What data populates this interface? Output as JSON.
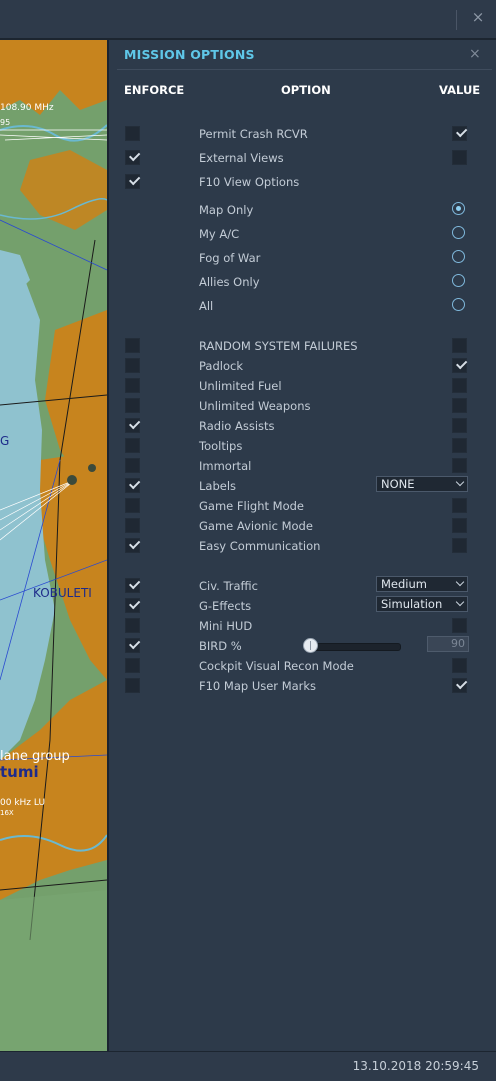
{
  "window": {
    "close_label": "×"
  },
  "map": {
    "freq_top": "108.90 MHz",
    "freq_top_sub": "95",
    "letter_g": "G",
    "town": "KOBULETI",
    "group": "lane group",
    "city": "tumi",
    "freq_bottom": "00 kHz LU",
    "freq_bottom_sub": "16X"
  },
  "panel": {
    "title": "MISSION OPTIONS",
    "close_label": "×",
    "headers": {
      "enforce": "ENFORCE",
      "option": "OPTION",
      "value": "VALUE"
    }
  },
  "options": [
    {
      "label": "Permit Crash RCVR",
      "enforce": false,
      "value_type": "checkbox",
      "value": true
    },
    {
      "label": "External Views",
      "enforce": true,
      "value_type": "checkbox",
      "value": false
    },
    {
      "label": "F10 View Options",
      "enforce": true,
      "value_type": "none"
    },
    {
      "label": "Map Only",
      "value_type": "radio",
      "value": true
    },
    {
      "label": "My A/C",
      "value_type": "radio",
      "value": false
    },
    {
      "label": "Fog of War",
      "value_type": "radio",
      "value": false
    },
    {
      "label": "Allies Only",
      "value_type": "radio",
      "value": false
    },
    {
      "label": "All",
      "value_type": "radio",
      "value": false
    },
    {
      "label": "RANDOM SYSTEM FAILURES",
      "enforce": false,
      "value_type": "checkbox",
      "value": false
    },
    {
      "label": "Padlock",
      "enforce": false,
      "value_type": "checkbox",
      "value": true
    },
    {
      "label": "Unlimited Fuel",
      "enforce": false,
      "value_type": "checkbox",
      "value": false
    },
    {
      "label": "Unlimited Weapons",
      "enforce": false,
      "value_type": "checkbox",
      "value": false
    },
    {
      "label": "Radio Assists",
      "enforce": true,
      "value_type": "checkbox",
      "value": false
    },
    {
      "label": "Tooltips",
      "enforce": false,
      "value_type": "checkbox",
      "value": false
    },
    {
      "label": "Immortal",
      "enforce": false,
      "value_type": "checkbox",
      "value": false
    },
    {
      "label": "Labels",
      "enforce": true,
      "value_type": "dropdown",
      "value": "NONE"
    },
    {
      "label": "Game Flight Mode",
      "enforce": false,
      "value_type": "checkbox",
      "value": false
    },
    {
      "label": "Game Avionic Mode",
      "enforce": false,
      "value_type": "checkbox",
      "value": false
    },
    {
      "label": "Easy Communication",
      "enforce": true,
      "value_type": "checkbox",
      "value": false
    },
    {
      "label": "Civ. Traffic",
      "enforce": true,
      "value_type": "dropdown",
      "value": "Medium"
    },
    {
      "label": "G-Effects",
      "enforce": true,
      "value_type": "dropdown",
      "value": "Simulation"
    },
    {
      "label": "Mini HUD",
      "enforce": false,
      "value_type": "checkbox",
      "value": false
    },
    {
      "label": "BIRD %",
      "enforce": true,
      "value_type": "slider",
      "value": "90",
      "slider_fraction": 0.0
    },
    {
      "label": "Cockpit Visual Recon Mode",
      "enforce": false,
      "value_type": "checkbox",
      "value": false
    },
    {
      "label": "F10 Map User Marks",
      "enforce": false,
      "value_type": "checkbox",
      "value": true
    }
  ],
  "status": {
    "datetime": "13.10.2018 20:59:45"
  }
}
